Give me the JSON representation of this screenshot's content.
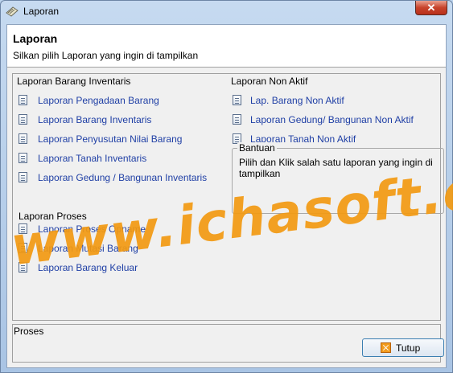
{
  "window": {
    "title": "Laporan",
    "close_glyph": "✕"
  },
  "header": {
    "title": "Laporan",
    "subtitle": "Silkan pilih Laporan yang ingin di tampilkan"
  },
  "inventaris": {
    "label": "Laporan Barang Inventaris",
    "items": [
      "Laporan Pengadaan Barang",
      "Laporan Barang Inventaris",
      "Laporan Penyusutan Nilai Barang",
      "Laporan Tanah Inventaris",
      "Laporan Gedung / Bangunan Inventaris"
    ]
  },
  "non_aktif": {
    "label": "Laporan Non Aktif",
    "items": [
      "Lap. Barang Non Aktif",
      "Laporan Gedung/ Bangunan Non Aktif",
      "Laporan Tanah Non Aktif"
    ]
  },
  "proses": {
    "label": "Laporan Proses",
    "items": [
      "Laporan Proses Opname",
      "Laporan Mutasi Barang",
      "Laporan Barang Keluar"
    ]
  },
  "bantuan": {
    "legend": "Bantuan",
    "text": "Pilih dan Klik salah satu laporan yang ingin di tampilkan"
  },
  "status": {
    "label": "Proses"
  },
  "footer": {
    "close_label": "Tutup"
  },
  "watermark": "www.ichasoft.com",
  "colors": {
    "link": "#1f3fa5",
    "watermark": "#f39a12",
    "close_button": "#c7432b"
  },
  "icons": {
    "window": "report-window-icon",
    "item": "document-icon",
    "close": "close-icon"
  }
}
